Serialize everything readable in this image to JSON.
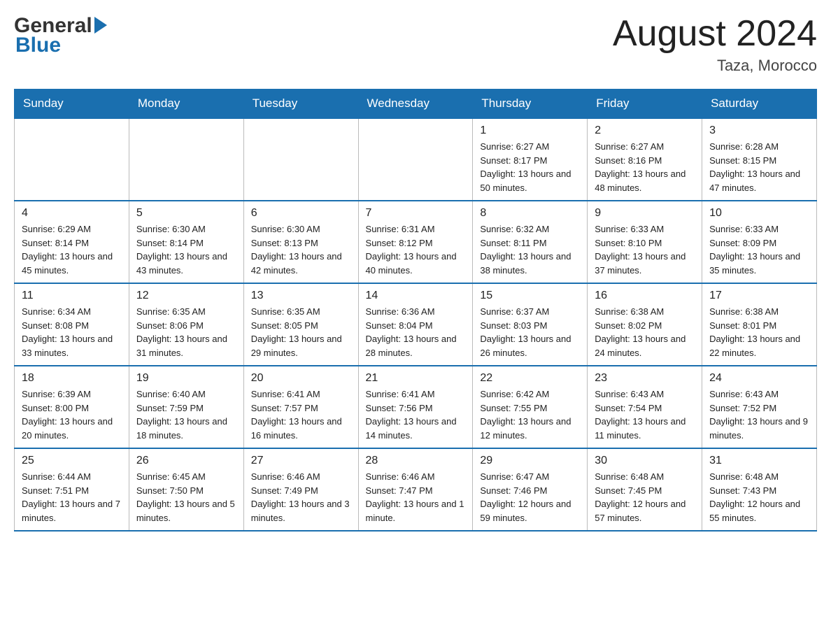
{
  "header": {
    "logo": {
      "general": "General",
      "blue": "Blue"
    },
    "title": "August 2024",
    "location": "Taza, Morocco"
  },
  "calendar": {
    "days_of_week": [
      "Sunday",
      "Monday",
      "Tuesday",
      "Wednesday",
      "Thursday",
      "Friday",
      "Saturday"
    ],
    "weeks": [
      [
        {
          "day": "",
          "info": ""
        },
        {
          "day": "",
          "info": ""
        },
        {
          "day": "",
          "info": ""
        },
        {
          "day": "",
          "info": ""
        },
        {
          "day": "1",
          "info": "Sunrise: 6:27 AM\nSunset: 8:17 PM\nDaylight: 13 hours and 50 minutes."
        },
        {
          "day": "2",
          "info": "Sunrise: 6:27 AM\nSunset: 8:16 PM\nDaylight: 13 hours and 48 minutes."
        },
        {
          "day": "3",
          "info": "Sunrise: 6:28 AM\nSunset: 8:15 PM\nDaylight: 13 hours and 47 minutes."
        }
      ],
      [
        {
          "day": "4",
          "info": "Sunrise: 6:29 AM\nSunset: 8:14 PM\nDaylight: 13 hours and 45 minutes."
        },
        {
          "day": "5",
          "info": "Sunrise: 6:30 AM\nSunset: 8:14 PM\nDaylight: 13 hours and 43 minutes."
        },
        {
          "day": "6",
          "info": "Sunrise: 6:30 AM\nSunset: 8:13 PM\nDaylight: 13 hours and 42 minutes."
        },
        {
          "day": "7",
          "info": "Sunrise: 6:31 AM\nSunset: 8:12 PM\nDaylight: 13 hours and 40 minutes."
        },
        {
          "day": "8",
          "info": "Sunrise: 6:32 AM\nSunset: 8:11 PM\nDaylight: 13 hours and 38 minutes."
        },
        {
          "day": "9",
          "info": "Sunrise: 6:33 AM\nSunset: 8:10 PM\nDaylight: 13 hours and 37 minutes."
        },
        {
          "day": "10",
          "info": "Sunrise: 6:33 AM\nSunset: 8:09 PM\nDaylight: 13 hours and 35 minutes."
        }
      ],
      [
        {
          "day": "11",
          "info": "Sunrise: 6:34 AM\nSunset: 8:08 PM\nDaylight: 13 hours and 33 minutes."
        },
        {
          "day": "12",
          "info": "Sunrise: 6:35 AM\nSunset: 8:06 PM\nDaylight: 13 hours and 31 minutes."
        },
        {
          "day": "13",
          "info": "Sunrise: 6:35 AM\nSunset: 8:05 PM\nDaylight: 13 hours and 29 minutes."
        },
        {
          "day": "14",
          "info": "Sunrise: 6:36 AM\nSunset: 8:04 PM\nDaylight: 13 hours and 28 minutes."
        },
        {
          "day": "15",
          "info": "Sunrise: 6:37 AM\nSunset: 8:03 PM\nDaylight: 13 hours and 26 minutes."
        },
        {
          "day": "16",
          "info": "Sunrise: 6:38 AM\nSunset: 8:02 PM\nDaylight: 13 hours and 24 minutes."
        },
        {
          "day": "17",
          "info": "Sunrise: 6:38 AM\nSunset: 8:01 PM\nDaylight: 13 hours and 22 minutes."
        }
      ],
      [
        {
          "day": "18",
          "info": "Sunrise: 6:39 AM\nSunset: 8:00 PM\nDaylight: 13 hours and 20 minutes."
        },
        {
          "day": "19",
          "info": "Sunrise: 6:40 AM\nSunset: 7:59 PM\nDaylight: 13 hours and 18 minutes."
        },
        {
          "day": "20",
          "info": "Sunrise: 6:41 AM\nSunset: 7:57 PM\nDaylight: 13 hours and 16 minutes."
        },
        {
          "day": "21",
          "info": "Sunrise: 6:41 AM\nSunset: 7:56 PM\nDaylight: 13 hours and 14 minutes."
        },
        {
          "day": "22",
          "info": "Sunrise: 6:42 AM\nSunset: 7:55 PM\nDaylight: 13 hours and 12 minutes."
        },
        {
          "day": "23",
          "info": "Sunrise: 6:43 AM\nSunset: 7:54 PM\nDaylight: 13 hours and 11 minutes."
        },
        {
          "day": "24",
          "info": "Sunrise: 6:43 AM\nSunset: 7:52 PM\nDaylight: 13 hours and 9 minutes."
        }
      ],
      [
        {
          "day": "25",
          "info": "Sunrise: 6:44 AM\nSunset: 7:51 PM\nDaylight: 13 hours and 7 minutes."
        },
        {
          "day": "26",
          "info": "Sunrise: 6:45 AM\nSunset: 7:50 PM\nDaylight: 13 hours and 5 minutes."
        },
        {
          "day": "27",
          "info": "Sunrise: 6:46 AM\nSunset: 7:49 PM\nDaylight: 13 hours and 3 minutes."
        },
        {
          "day": "28",
          "info": "Sunrise: 6:46 AM\nSunset: 7:47 PM\nDaylight: 13 hours and 1 minute."
        },
        {
          "day": "29",
          "info": "Sunrise: 6:47 AM\nSunset: 7:46 PM\nDaylight: 12 hours and 59 minutes."
        },
        {
          "day": "30",
          "info": "Sunrise: 6:48 AM\nSunset: 7:45 PM\nDaylight: 12 hours and 57 minutes."
        },
        {
          "day": "31",
          "info": "Sunrise: 6:48 AM\nSunset: 7:43 PM\nDaylight: 12 hours and 55 minutes."
        }
      ]
    ]
  }
}
